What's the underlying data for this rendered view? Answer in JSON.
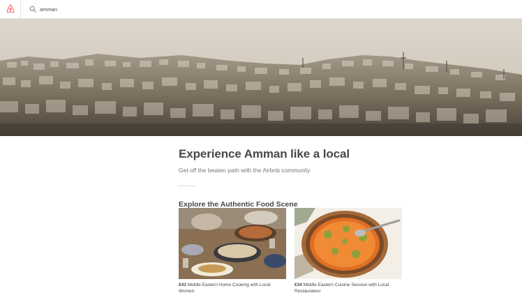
{
  "header": {
    "logo_icon": "airbnb-logo-icon",
    "search": {
      "icon": "search-icon",
      "value": "amman"
    }
  },
  "hero": {
    "image": "amman-cityscape"
  },
  "main": {
    "title": "Experience Amman like a local",
    "subtitle": "Get off the beaten path with the Airbnb community",
    "section_title": "Explore the Authentic Food Scene",
    "cards": [
      {
        "price": "€43",
        "title": "Middle Eastern Home Cooking with Local Women",
        "image": "food-table-photo"
      },
      {
        "price": "€34",
        "title": "Middle Eastern Cuisine Session with Local Restaurateur",
        "image": "knafeh-plate-photo"
      }
    ]
  },
  "colors": {
    "brand": "#FF5A5F",
    "text": "#484848",
    "muted": "#767676"
  }
}
